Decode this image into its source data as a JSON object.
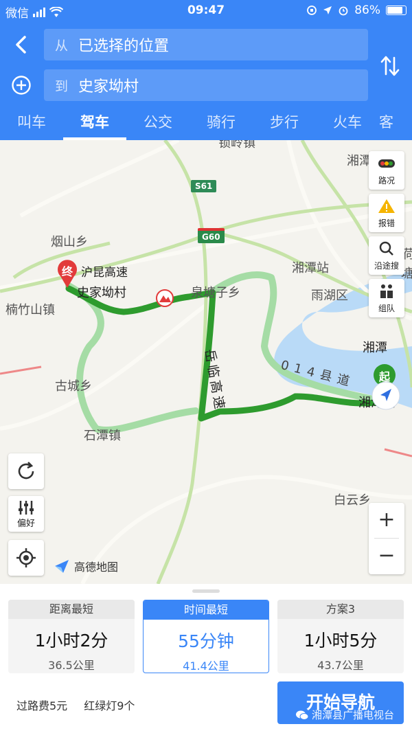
{
  "status_bar": {
    "carrier": "微信",
    "time": "09:47",
    "battery": "86%",
    "battery_level": 0.86
  },
  "route_input": {
    "from_prefix": "从",
    "from_value": "已选择的位置",
    "to_prefix": "到",
    "to_value": "史家坳村"
  },
  "tabs": [
    "叫车",
    "驾车",
    "公交",
    "骑行",
    "步行",
    "火车",
    "客"
  ],
  "active_tab": "驾车",
  "map": {
    "labels": {
      "top_town": "锁岭镇",
      "xiangtan_top": "湘潭",
      "yanshan": "烟山乡",
      "hukun": "沪昆高速",
      "destination": "史家坳村",
      "nanzhushan": "楠竹山镇",
      "quantangzi": "泉塘子乡",
      "xiangtan_station": "湘潭站",
      "yuhu": "雨湖区",
      "xiangtan": "湘潭",
      "guchen": "古城乡",
      "shitan": "石潭镇",
      "county_road": "014县道",
      "xiangtan_county": "湘潭县",
      "baiyun": "白云乡",
      "yueling_highway": "岳临高速",
      "he": "荷",
      "tang": "塘"
    },
    "shields": {
      "s61": "S61",
      "g60": "G60"
    },
    "markers": {
      "end": "终",
      "start": "起"
    },
    "side_buttons": [
      {
        "label": "路况",
        "icon": "traffic-icon"
      },
      {
        "label": "报错",
        "icon": "warning-icon"
      },
      {
        "label": "沿途搜",
        "icon": "search-icon"
      },
      {
        "label": "组队",
        "icon": "team-icon"
      }
    ],
    "preference_label": "偏好",
    "zoom_in": "+",
    "zoom_out": "−",
    "logo_text": "高德地图"
  },
  "routes": [
    {
      "title": "距离最短",
      "time": "1小时2分",
      "distance": "36.5公里",
      "active": false
    },
    {
      "title": "时间最短",
      "time": "55分钟",
      "distance": "41.4公里",
      "active": true
    },
    {
      "title": "方案3",
      "time": "1小时5分",
      "distance": "43.7公里",
      "active": false
    }
  ],
  "info": {
    "toll": "过路费5元",
    "traffic_lights": "红绿灯9个"
  },
  "start_nav_label": "开始导航",
  "watermark": "湘潭县广播电视台",
  "colors": {
    "accent": "#3a86f7",
    "route_active": "#2e9b2e",
    "route_alt": "#9fd89f"
  }
}
